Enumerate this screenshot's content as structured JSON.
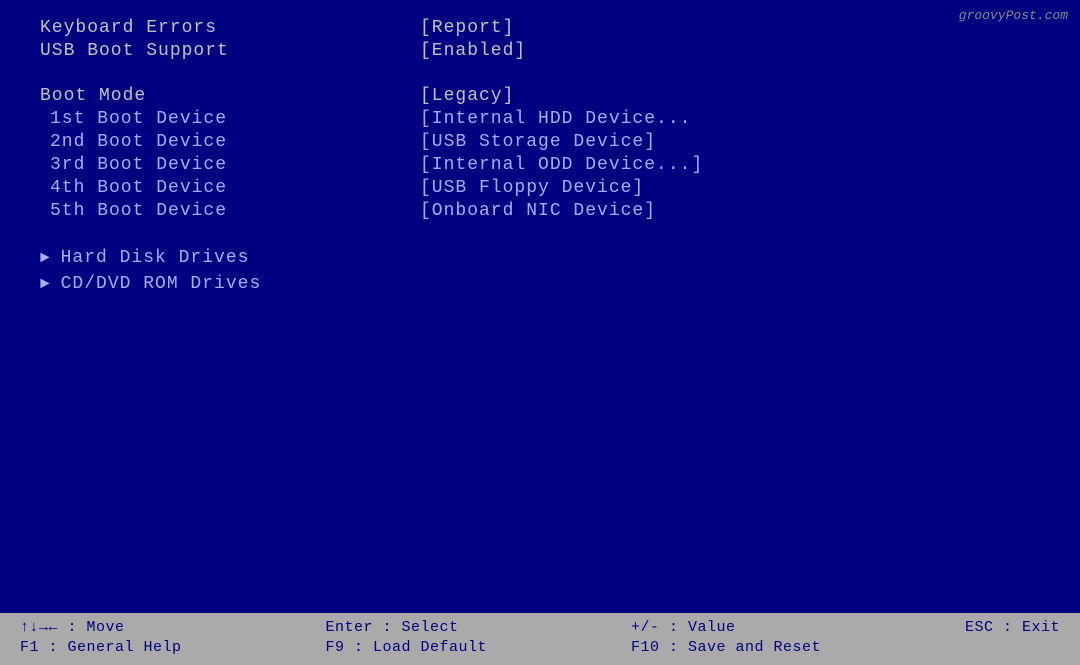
{
  "watermark": "groovyPost.com",
  "top_items": [
    {
      "label": "Keyboard Errors",
      "value": "[Report]"
    },
    {
      "label": "USB Boot Support",
      "value": "[Enabled]"
    }
  ],
  "boot_mode": {
    "label": "Boot Mode",
    "value": "[Legacy]"
  },
  "boot_devices": [
    {
      "label": "1st Boot Device",
      "value": "[Internal HDD Device..."
    },
    {
      "label": "2nd Boot Device",
      "value": "[USB Storage Device]"
    },
    {
      "label": "3rd Boot Device",
      "value": "[Internal ODD Device...]"
    },
    {
      "label": "4th Boot Device",
      "value": "[USB Floppy Device]"
    },
    {
      "label": "5th Boot Device",
      "value": "[Onboard NIC Device]"
    }
  ],
  "drives": [
    "Hard Disk Drives",
    "CD/DVD ROM Drives"
  ],
  "footer": {
    "col1_line1": "↑↓→← : Move",
    "col1_line2": "F1 : General Help",
    "col2_line1": "Enter : Select",
    "col2_line2": "F9 : Load Default",
    "col3_line1": "+/- : Value",
    "col3_line2": "F10 : Save and Reset",
    "col4_line1": "ESC : Exit",
    "col4_line2": ""
  }
}
